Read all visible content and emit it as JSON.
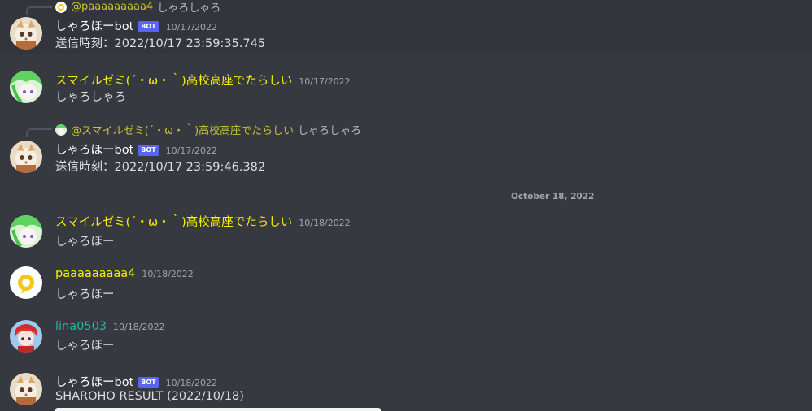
{
  "messages": [
    {
      "reply": {
        "name": "@paaaaaaaaa4",
        "text": "しゃろしゃろ"
      },
      "author": "しゃろほーbot",
      "bot_tag": "BOT",
      "timestamp": "10/17/2022",
      "content": "送信時刻：2022/10/17 23:59:35.745"
    },
    {
      "author": "スマイルゼミ(´・ω・｀)高校高座でたらしい",
      "timestamp": "10/17/2022",
      "content": "しゃろしゃろ"
    },
    {
      "reply": {
        "name": "@スマイルゼミ(´・ω・｀)高校高座でたらしい",
        "text": "しゃろしゃろ"
      },
      "author": "しゃろほーbot",
      "bot_tag": "BOT",
      "timestamp": "10/17/2022",
      "content": "送信時刻：2022/10/17 23:59:46.382"
    },
    {
      "author": "スマイルゼミ(´・ω・｀)高校高座でたらしい",
      "timestamp": "10/18/2022",
      "content": "しゃろほー"
    },
    {
      "author": "paaaaaaaaa4",
      "timestamp": "10/18/2022",
      "content": "しゃろほー"
    },
    {
      "author": "lina0503",
      "timestamp": "10/18/2022",
      "content": "しゃろほー"
    },
    {
      "author": "しゃろほーbot",
      "bot_tag": "BOT",
      "timestamp": "10/18/2022",
      "content": "SHAROHO RESULT (2022/10/18)"
    }
  ],
  "divider": {
    "label": "October 18, 2022"
  },
  "colors": {
    "background": "#36393f",
    "username_yellow": "#f5f000",
    "username_teal": "#1abc9c",
    "bot_tag": "#5865f2",
    "timestamp": "#a3a6aa"
  },
  "icons": {
    "bot_avatar": "cat-avatar",
    "smile_avatar": "anime-character-avatar",
    "paa_avatar": "yellow-ring-avatar",
    "lina_avatar": "red-hair-character-avatar"
  }
}
